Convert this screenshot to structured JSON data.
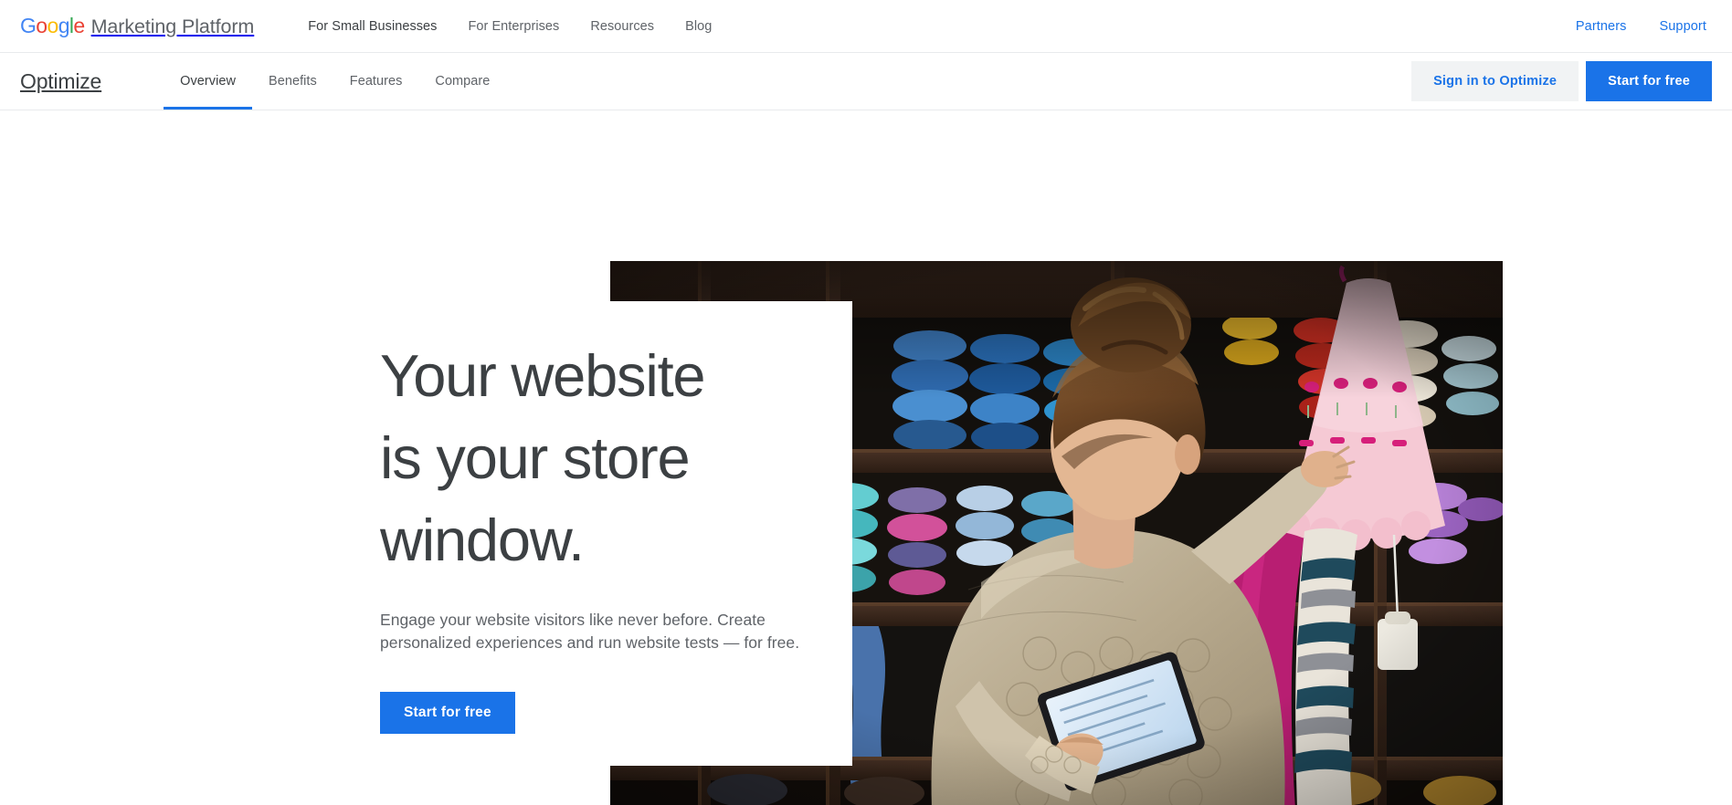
{
  "topbar": {
    "logo": {
      "google_letters": [
        {
          "ch": "G",
          "color": "#4285f4"
        },
        {
          "ch": "o",
          "color": "#ea4335"
        },
        {
          "ch": "o",
          "color": "#fbbc05"
        },
        {
          "ch": "g",
          "color": "#4285f4"
        },
        {
          "ch": "l",
          "color": "#34a853"
        },
        {
          "ch": "e",
          "color": "#ea4335"
        }
      ],
      "suffix": "Marketing Platform"
    },
    "nav": [
      {
        "label": "For Small Businesses"
      },
      {
        "label": "For Enterprises"
      },
      {
        "label": "Resources"
      },
      {
        "label": "Blog"
      }
    ],
    "right_links": [
      {
        "label": "Partners"
      },
      {
        "label": "Support"
      }
    ]
  },
  "productbar": {
    "product_name": "Optimize",
    "tabs": [
      {
        "label": "Overview",
        "active": true
      },
      {
        "label": "Benefits",
        "active": false
      },
      {
        "label": "Features",
        "active": false
      },
      {
        "label": "Compare",
        "active": false
      }
    ],
    "signin_label": "Sign in to Optimize",
    "start_label": "Start for free"
  },
  "hero": {
    "title": "Your website\nis your store\nwindow.",
    "subtitle": "Engage your website visitors like never before. Create\npersonalized experiences and run website tests — for free.",
    "cta_label": "Start for free",
    "image_alt": "woman-browsing-yarn-shelves-with-tablet"
  },
  "colors": {
    "brand_blue": "#1a73e8",
    "text_primary": "#3c4043",
    "text_secondary": "#5f6368",
    "button_secondary_bg": "#f1f3f4",
    "divider": "#e8eaed"
  }
}
